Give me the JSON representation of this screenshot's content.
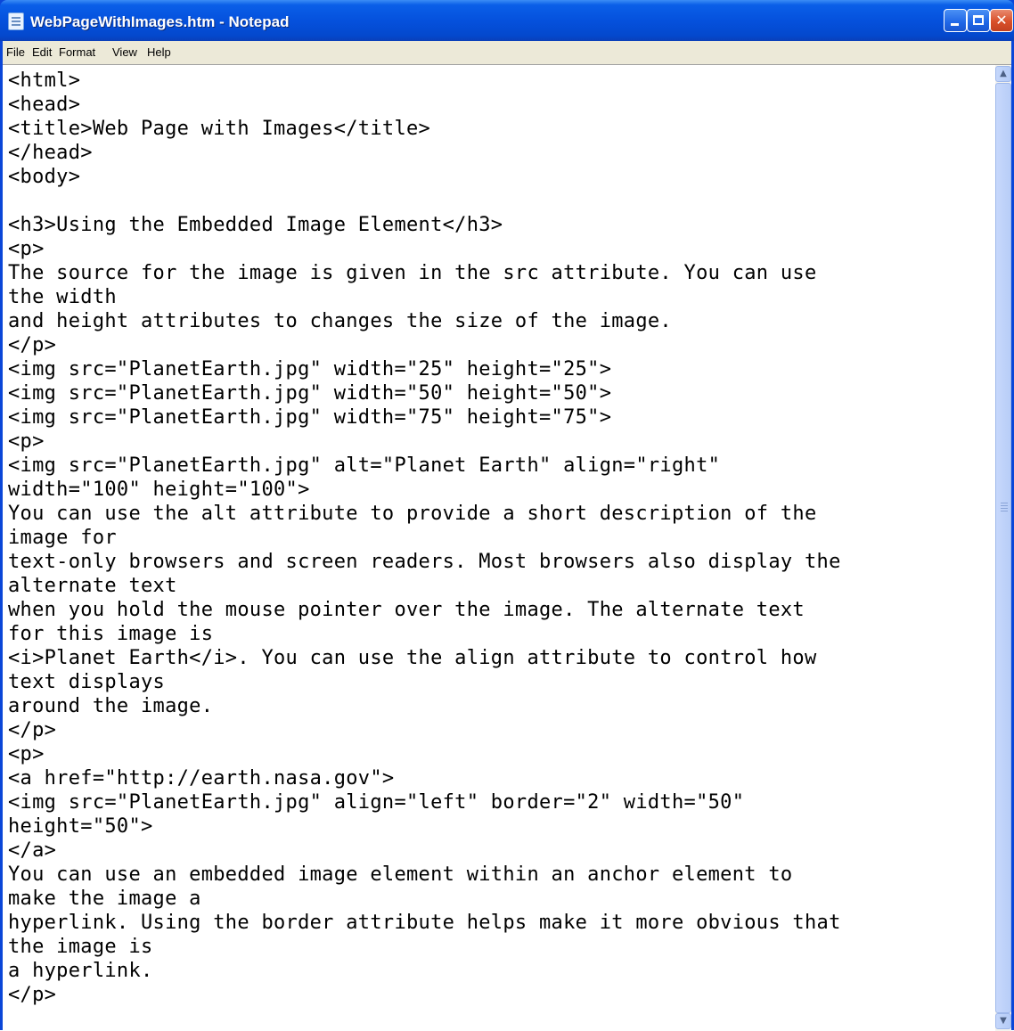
{
  "window": {
    "title": "WebPageWithImages.htm - Notepad",
    "icon": "notepad-icon",
    "controls": {
      "minimize": "minimize-icon",
      "maximize": "maximize-icon",
      "close": "close-icon"
    }
  },
  "menu": {
    "file": "File",
    "edit": "Edit",
    "format": "Format",
    "view": "View",
    "help": "Help"
  },
  "editor": {
    "lines": [
      "<html>",
      "<head>",
      "<title>Web Page with Images</title>",
      "</head>",
      "<body>",
      "",
      "<h3>Using the Embedded Image Element</h3>",
      "<p>",
      "The source for the image is given in the src attribute. You can use",
      "the width",
      "and height attributes to changes the size of the image.",
      "</p>",
      "<img src=\"PlanetEarth.jpg\" width=\"25\" height=\"25\">",
      "<img src=\"PlanetEarth.jpg\" width=\"50\" height=\"50\">",
      "<img src=\"PlanetEarth.jpg\" width=\"75\" height=\"75\">",
      "<p>",
      "<img src=\"PlanetEarth.jpg\" alt=\"Planet Earth\" align=\"right\"",
      "width=\"100\" height=\"100\">",
      "You can use the alt attribute to provide a short description of the",
      "image for",
      "text-only browsers and screen readers. Most browsers also display the",
      "alternate text",
      "when you hold the mouse pointer over the image. The alternate text",
      "for this image is",
      "<i>Planet Earth</i>. You can use the align attribute to control how",
      "text displays",
      "around the image.",
      "</p>",
      "<p>",
      "<a href=\"http://earth.nasa.gov\">",
      "<img src=\"PlanetEarth.jpg\" align=\"left\" border=\"2\" width=\"50\"",
      "height=\"50\">",
      "</a>",
      "You can use an embedded image element within an anchor element to",
      "make the image a",
      "hyperlink. Using the border attribute helps make it more obvious that",
      "the image is",
      "a hyperlink.",
      "</p>"
    ]
  },
  "scrollbar": {
    "up": "scroll-up-arrow-icon",
    "down": "scroll-down-arrow-icon"
  },
  "colors": {
    "titlebar": "#0551dd",
    "menubar": "#ece9d8",
    "close_button": "#d9502a",
    "editor_background": "#ffffff"
  }
}
